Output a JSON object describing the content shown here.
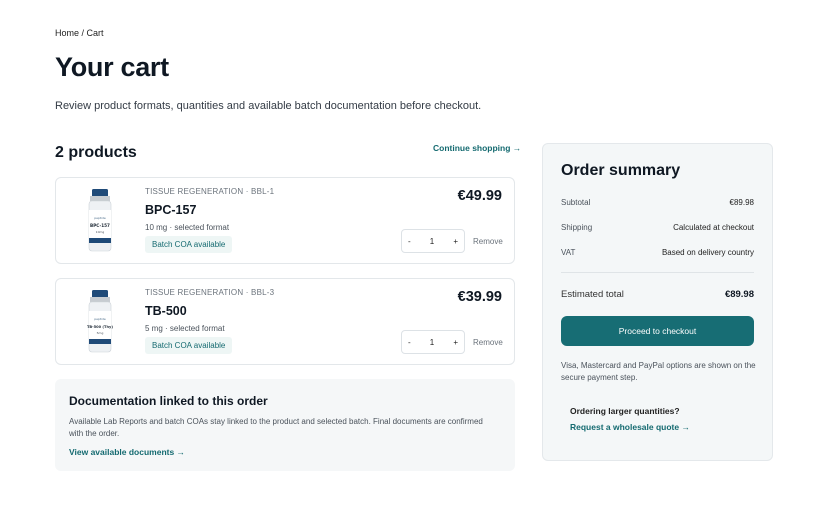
{
  "breadcrumb": "Home / Cart",
  "page_title": "Your cart",
  "intro": "Review product formats, quantities and available batch documentation before checkout.",
  "cart": {
    "count_label": "2 products",
    "continue_label": "Continue shopping →",
    "items": [
      {
        "category": "TISSUE REGENERATION · BBL-1",
        "name": "BPC-157",
        "format": "10 mg · selected format",
        "badge": "Batch COA available",
        "price": "€49.99",
        "minus": "-",
        "qty": "1",
        "plus": "+",
        "remove": "Remove",
        "vial_label": "BPC-157",
        "vial_dose": "10mg"
      },
      {
        "category": "TISSUE REGENERATION · BBL-3",
        "name": "TB-500",
        "format": "5 mg · selected format",
        "badge": "Batch COA available",
        "price": "€39.99",
        "minus": "-",
        "qty": "1",
        "plus": "+",
        "remove": "Remove",
        "vial_label": "TB-500 (Thy)",
        "vial_dose": "5mg"
      }
    ]
  },
  "documentation": {
    "title": "Documentation linked to this order",
    "text": "Available Lab Reports and batch COAs stay linked to the product and selected batch. Final documents are confirmed with the order.",
    "link": "View available documents →"
  },
  "summary": {
    "title": "Order summary",
    "subtotal_label": "Subtotal",
    "subtotal_value": "€89.98",
    "shipping_label": "Shipping",
    "shipping_value": "Calculated at checkout",
    "vat_label": "VAT",
    "vat_value": "Based on delivery country",
    "total_label": "Estimated total",
    "total_value": "€89.98",
    "checkout_label": "Proceed to checkout",
    "payment_note": "Visa, Mastercard and PayPal options are shown on the secure payment step.",
    "bulk_question": "Ordering larger quantities?",
    "bulk_link": "Request a wholesale quote →"
  },
  "colors": {
    "accent": "#176d74",
    "vial_cap": "#1f4a78"
  }
}
